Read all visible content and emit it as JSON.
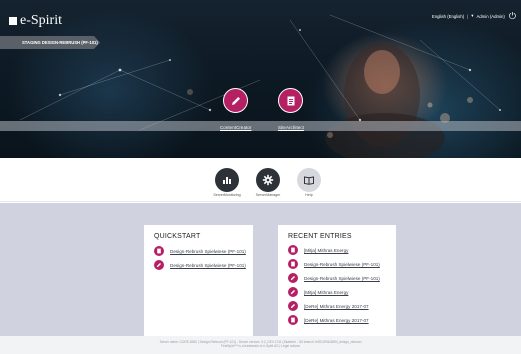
{
  "header": {
    "logo_text": "e-Spirit",
    "language": "English (English)",
    "user": "Admin (Admin)",
    "project_banner": "STAGING DESIGN-REBRUSH (PF-101)"
  },
  "launchers": [
    {
      "label": "ContentCreator",
      "icon": "pencil-icon"
    },
    {
      "label": "SiteArchitect",
      "icon": "document-icon"
    }
  ],
  "apps": [
    {
      "label": "ServerMonitoring",
      "icon": "bar-chart-icon"
    },
    {
      "label": "ServerManager",
      "icon": "gear-icon"
    },
    {
      "label": "Help",
      "icon": "book-icon"
    }
  ],
  "quickstart": {
    "title": "QUICKSTART",
    "items": [
      {
        "label": "Design-Rebrush Spielwiese (PF-101)",
        "icon": "document-icon"
      },
      {
        "label": "Design-Rebrush Spielwiese (PF-101)",
        "icon": "pencil-icon"
      }
    ]
  },
  "recent": {
    "title": "RECENT ENTRIES",
    "items": [
      {
        "label": "[Mitja] Mithras Energy",
        "icon": "document-icon"
      },
      {
        "label": "Design-Rebrush Spielwiese (PF-101)",
        "icon": "document-icon"
      },
      {
        "label": "Design-Rebrush Spielwiese (PF-101)",
        "icon": "pencil-icon"
      },
      {
        "label": "[Mitja] Mithras Energy",
        "icon": "pencil-icon"
      },
      {
        "label": "[DeRe] Mithras Energy 2017-07",
        "icon": "pencil-icon"
      },
      {
        "label": "[DeRe] Mithras Energy 2017-07",
        "icon": "document-icon"
      }
    ]
  },
  "footer": {
    "line1": "Server name: CORE-8280 | Design-Rebrush (PF-101) - Server version: 5.2_DEV.1741 (Skalierte - Git branch: feSD1996-8894_design_rebrush",
    "line2": "FirstSpirit™ is a trademark of e-Spirit AG | Legal notices"
  },
  "colors": {
    "accent": "#b51f63",
    "app_dark": "#2d3138",
    "content_bg": "#d0d3df"
  }
}
